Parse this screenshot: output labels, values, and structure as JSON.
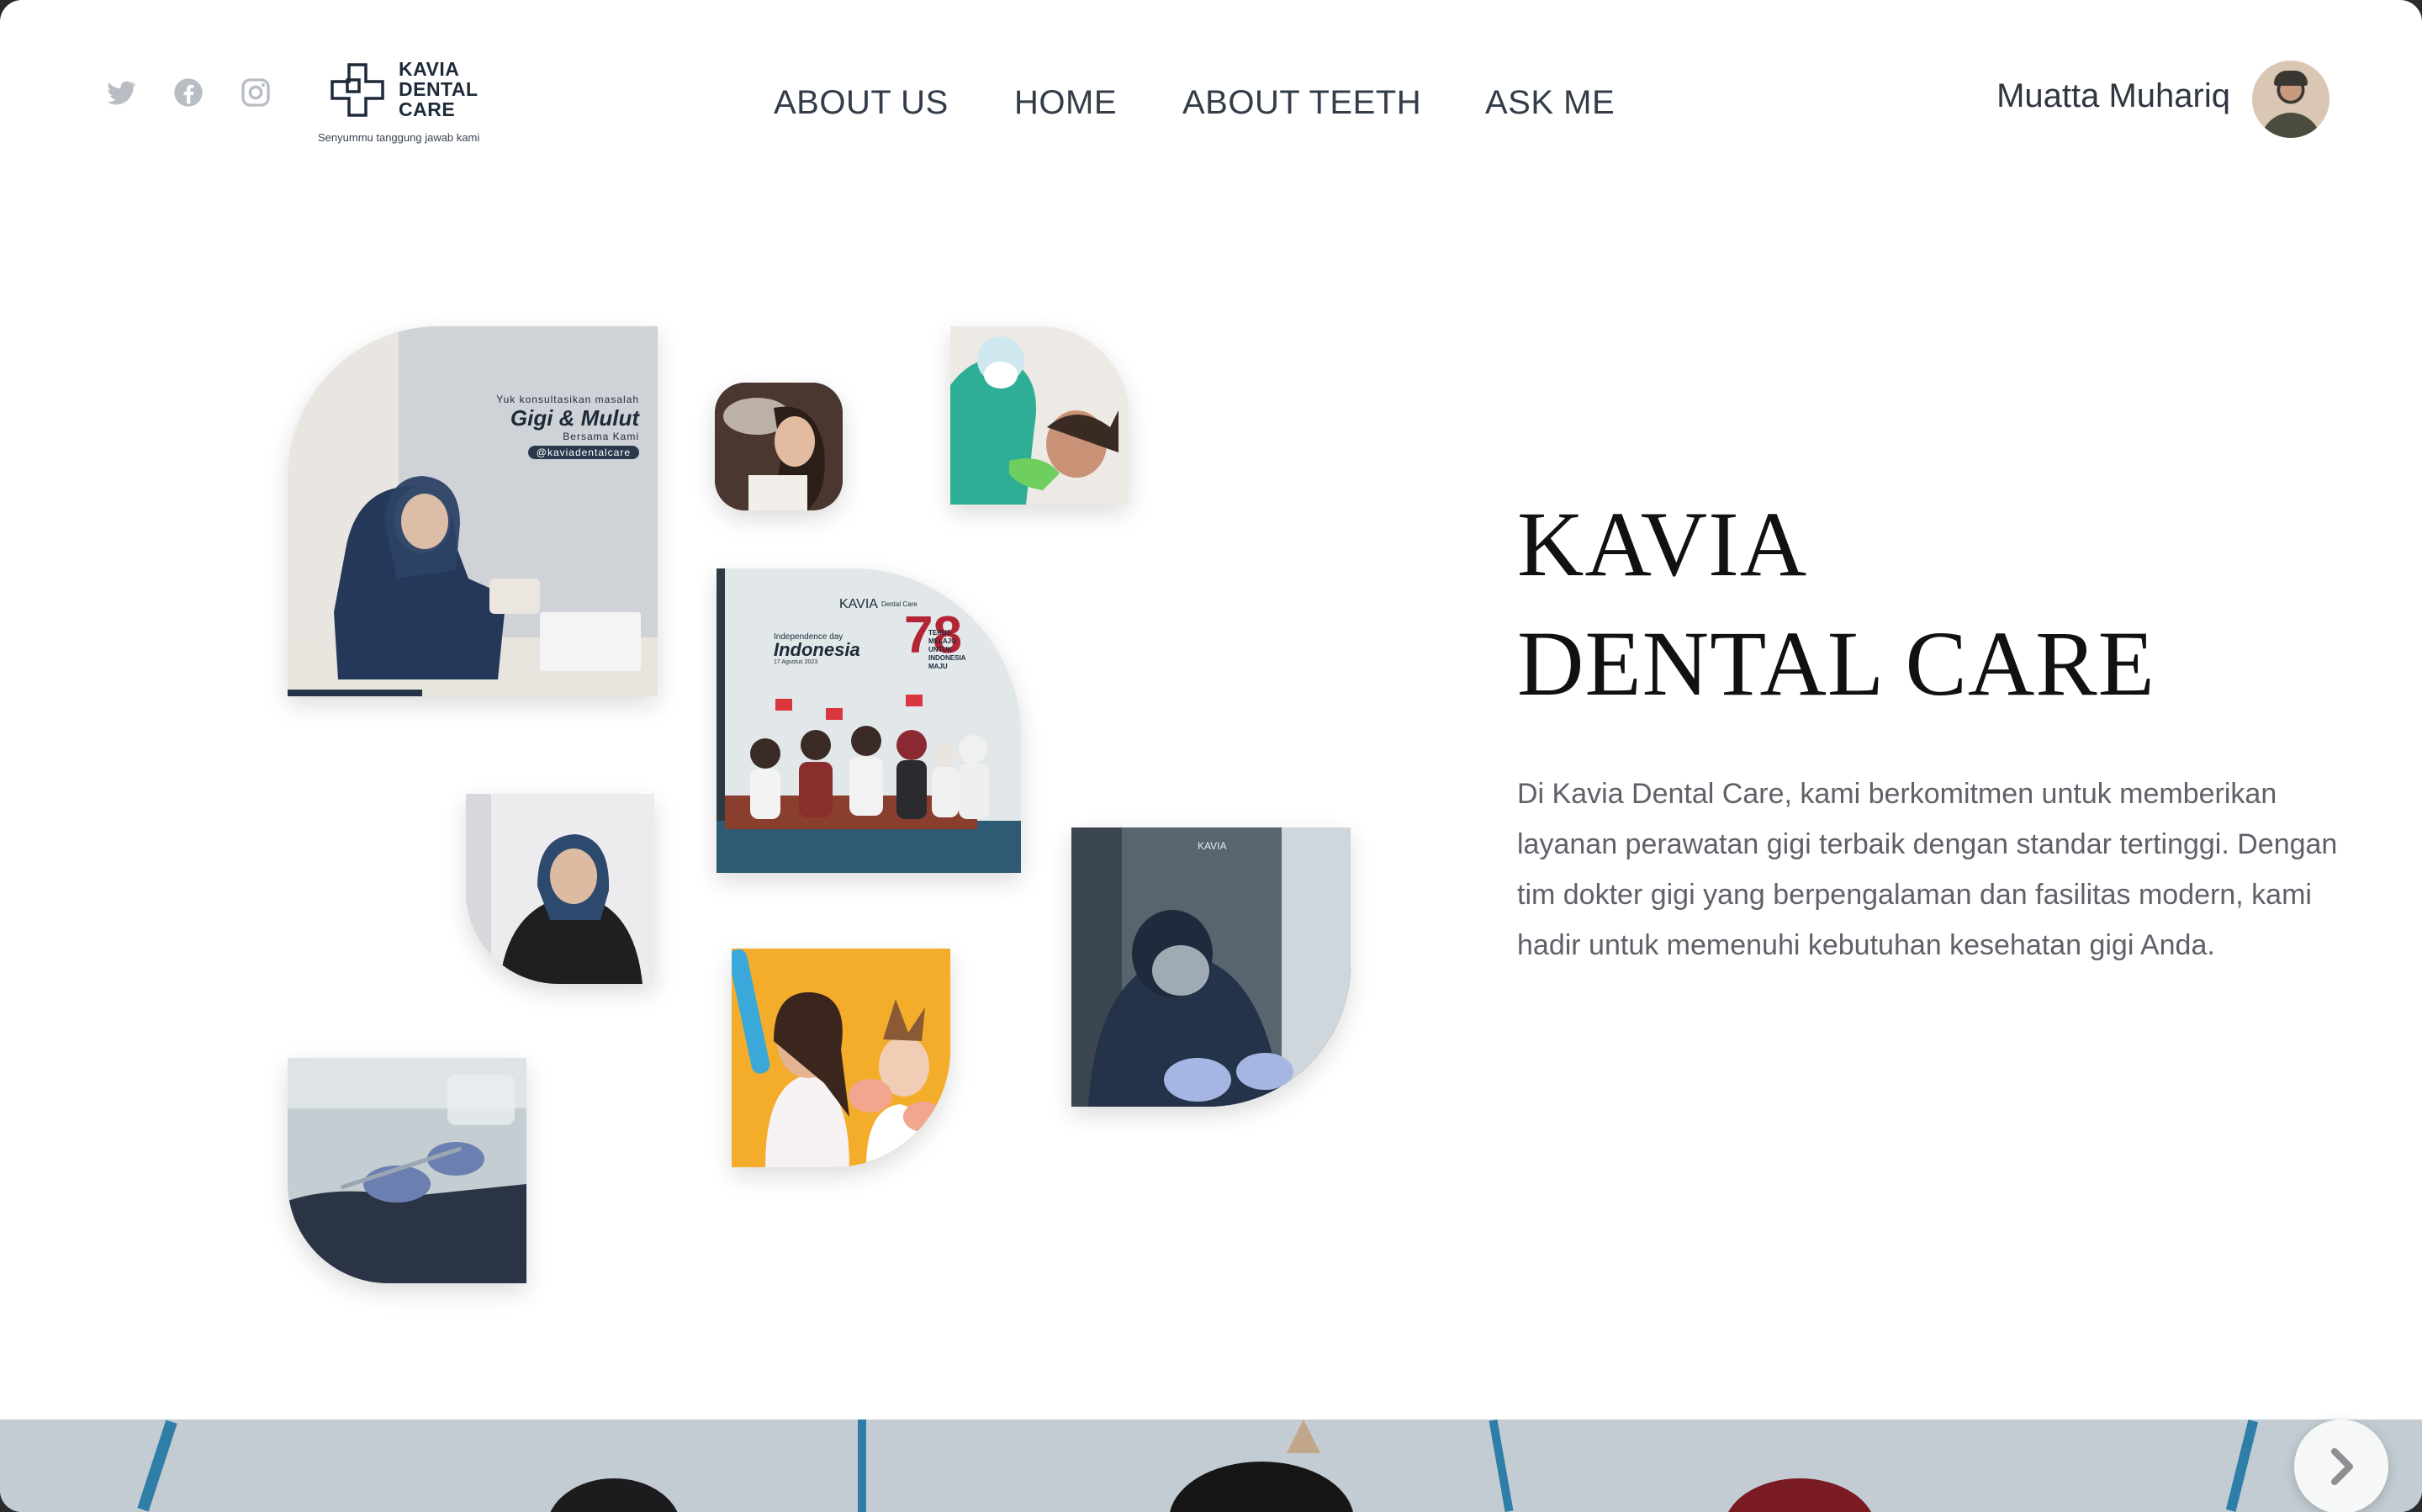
{
  "header": {
    "social": [
      {
        "icon": "twitter-icon"
      },
      {
        "icon": "facebook-icon"
      },
      {
        "icon": "instagram-icon"
      }
    ],
    "logo": {
      "name": "KAVIA\nDENTAL\nCARE",
      "tagline": "Senyummu tanggung jawab kami"
    },
    "nav": [
      {
        "label": "ABOUT US"
      },
      {
        "label": "HOME"
      },
      {
        "label": "ABOUT TEETH"
      },
      {
        "label": "ASK ME"
      }
    ],
    "user": {
      "name": "Muatta Muhariq",
      "avatar": "user-avatar"
    }
  },
  "hero": {
    "title_line1": "KAVIA",
    "title_line2": "DENTAL CARE",
    "description": "Di Kavia Dental Care, kami berkomitmen untuk memberikan layanan perawatan gigi terbaik dengan standar tertinggi. Dengan tim dokter gigi yang berpengalaman dan fasilitas modern, kami hadir untuk memenuhi kebutuhan kesehatan gigi Anda."
  },
  "gallery": {
    "photo1": {
      "line1": "Yuk konsultasikan masalah",
      "line2": "Gigi & Mulut",
      "line3": "Bersama Kami",
      "line4": "@kaviadentalcare"
    },
    "photo4": {
      "brand": "KAVIA",
      "brand_sub": "Dental Care",
      "line1": "Independence day",
      "line2": "Indonesia",
      "line3": "17 Agustus 2023",
      "number": "78",
      "side": "TERUS MELAJU UNTUK INDONESIA MAJU"
    }
  },
  "banner": {
    "next_icon": "chevron-right-icon"
  },
  "colors": {
    "background": "#ffffff",
    "text_dark": "#111111",
    "text_muted": "#5e6168",
    "social_icon": "#b8bdc4"
  }
}
